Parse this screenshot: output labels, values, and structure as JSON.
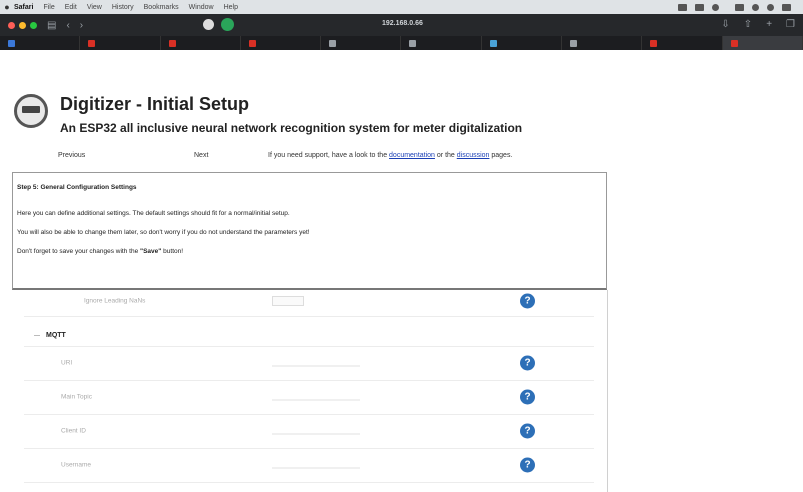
{
  "menubar": {
    "app_name": "Safari",
    "items": [
      "File",
      "Edit",
      "View",
      "History",
      "Bookmarks",
      "Window",
      "Help"
    ],
    "battery": "",
    "clock": ""
  },
  "browser": {
    "address": "192.168.0.66",
    "address_extra": "",
    "tabs": [
      {
        "label": "",
        "color": "#3b78d8"
      },
      {
        "label": "",
        "color": "#d93025"
      },
      {
        "label": "",
        "color": "#d93025"
      },
      {
        "label": "",
        "color": "#d93025"
      },
      {
        "label": "",
        "color": "#9aa0a6"
      },
      {
        "label": "",
        "color": "#9aa0a6"
      },
      {
        "label": "",
        "color": "#4aa3d8"
      },
      {
        "label": "",
        "color": "#9aa0a6"
      },
      {
        "label": "",
        "color": "#d93025"
      },
      {
        "label": "",
        "color": "#d93025"
      }
    ]
  },
  "header": {
    "title": "Digitizer - Initial Setup",
    "subtitle": "An ESP32 all inclusive neural network recognition system for meter digitalization"
  },
  "nav": {
    "previous": "Previous",
    "next": "Next",
    "support_prefix": "If you need support, have a look to the ",
    "documentation": "documentation",
    "support_mid": " or the ",
    "discussion": "discussion",
    "support_suffix": " pages."
  },
  "step": {
    "heading": "Step 5: General Configuration Settings",
    "line1": "Here you can define additional settings. The default settings should fit for a normal/initial setup.",
    "line2": "You will also be able to change them later, so don't worry if you do not understand the parameters yet!",
    "line3_prefix": "Don't forget to save your changes with the ",
    "line3_bold": "\"Save\"",
    "line3_suffix": " button!"
  },
  "settings": {
    "ignore_leading_nan_label": "Ignore Leading NaNs",
    "ignore_leading_nan_value": "",
    "mqtt_section": "MQTT",
    "uri_label": "URI",
    "main_topic_label": "Main Topic",
    "client_id_label": "Client ID",
    "username_label": "Username",
    "help_glyph": "?"
  },
  "colors": {
    "help_icon": "#2d6fb7",
    "link": "#1a3fb5",
    "toolbar": "#26282b"
  }
}
